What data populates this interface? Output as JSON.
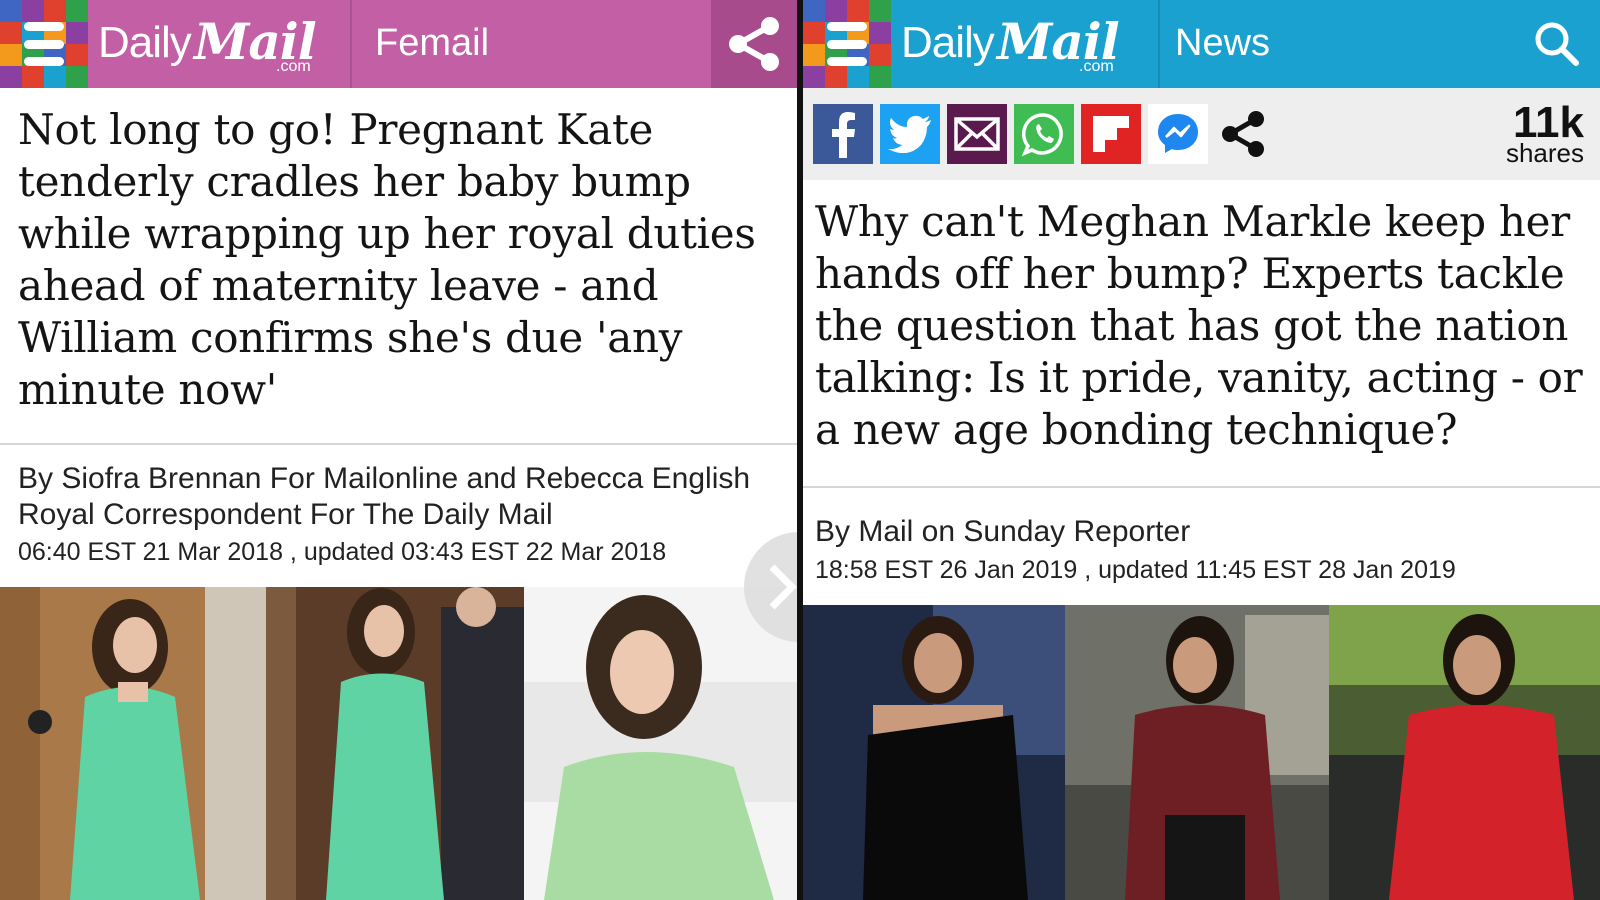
{
  "left": {
    "brand": {
      "daily": "Daily",
      "mail": "Mail",
      "com": ".com"
    },
    "section": "Femail",
    "header_color": "#c25fa5",
    "headline": "Not long to go! Pregnant Kate tenderly cradles her baby bump while wrapping up her royal duties ahead of maternity leave - and William confirms she's due 'any minute now'",
    "byline": "By Siofra Brennan For Mailonline and Rebecca English Royal Correspondent For The Daily Mail",
    "dateline": "06:40 EST 21 Mar 2018 , updated 03:43 EST 22 Mar 2018",
    "icons": {
      "menu": "menu-icon",
      "share": "share-icon",
      "next": "chevron-right-icon"
    }
  },
  "right": {
    "brand": {
      "daily": "Daily",
      "mail": "Mail",
      "com": ".com"
    },
    "section": "News",
    "header_color": "#1ba1cf",
    "share_count": "11k",
    "share_label": "shares",
    "share_buttons": [
      "facebook-icon",
      "twitter-icon",
      "email-icon",
      "whatsapp-icon",
      "flipboard-icon",
      "messenger-icon",
      "share-icon"
    ],
    "headline": "Why can't Meghan Markle keep her hands off her bump? Experts tackle the question that has got the nation talking: Is it pride, vanity, acting - or a new age bonding technique?",
    "byline": "By Mail on Sunday Reporter",
    "dateline": "18:58 EST 26 Jan 2019 , updated 11:45 EST 28 Jan 2019",
    "icons": {
      "menu": "menu-icon",
      "search": "search-icon"
    }
  }
}
